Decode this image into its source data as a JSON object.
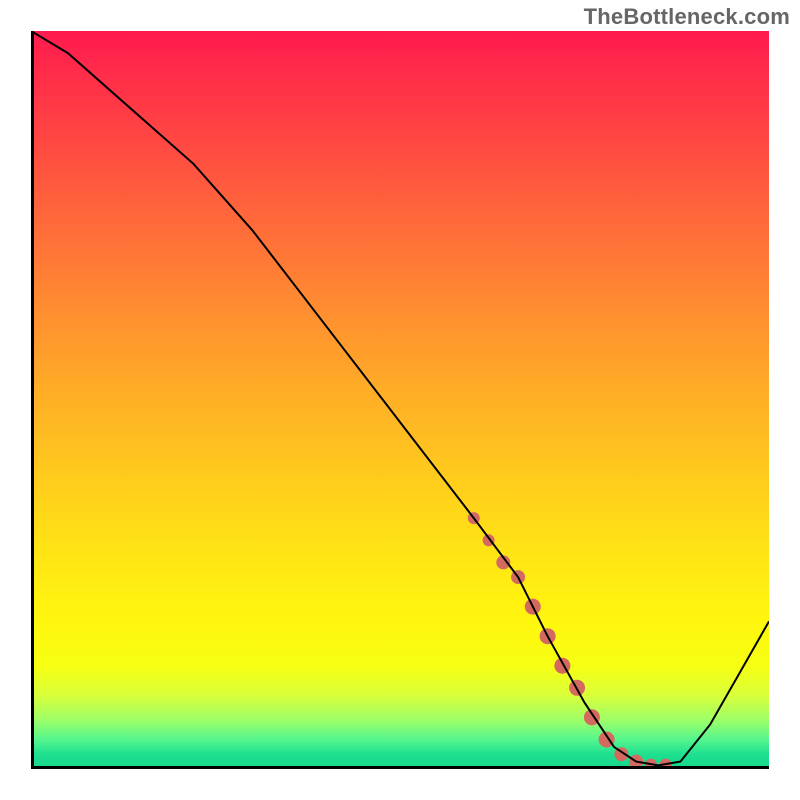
{
  "watermark": "TheBottleneck.com",
  "colors": {
    "gradient_top": "#ff1a4e",
    "gradient_bottom": "#17d68c",
    "curve": "#000000",
    "markers": "#d46a5f",
    "axis": "#000000"
  },
  "chart_data": {
    "type": "line",
    "title": "",
    "xlabel": "",
    "ylabel": "",
    "xlim": [
      0,
      100
    ],
    "ylim": [
      0,
      100
    ],
    "grid": false,
    "legend": false,
    "series": [
      {
        "name": "bottleneck-curve",
        "x": [
          0,
          5,
          22,
          30,
          40,
          50,
          60,
          66,
          70,
          75,
          79,
          82,
          85,
          88,
          92,
          96,
          100
        ],
        "values": [
          100,
          97,
          82,
          73,
          60,
          47,
          34,
          26,
          18,
          9,
          3,
          1,
          0.5,
          1,
          6,
          13,
          20
        ]
      }
    ],
    "markers": {
      "name": "highlighted-segment",
      "x": [
        60,
        62,
        64,
        66,
        68,
        70,
        72,
        74,
        76,
        78,
        80,
        82,
        84,
        86
      ],
      "values": [
        34,
        31,
        28,
        26,
        22,
        18,
        14,
        11,
        7,
        4,
        2,
        1,
        0.6,
        0.6
      ],
      "radius": [
        6,
        6,
        7,
        7,
        8,
        8,
        8,
        8,
        8,
        8,
        7,
        7,
        6,
        6
      ]
    }
  }
}
